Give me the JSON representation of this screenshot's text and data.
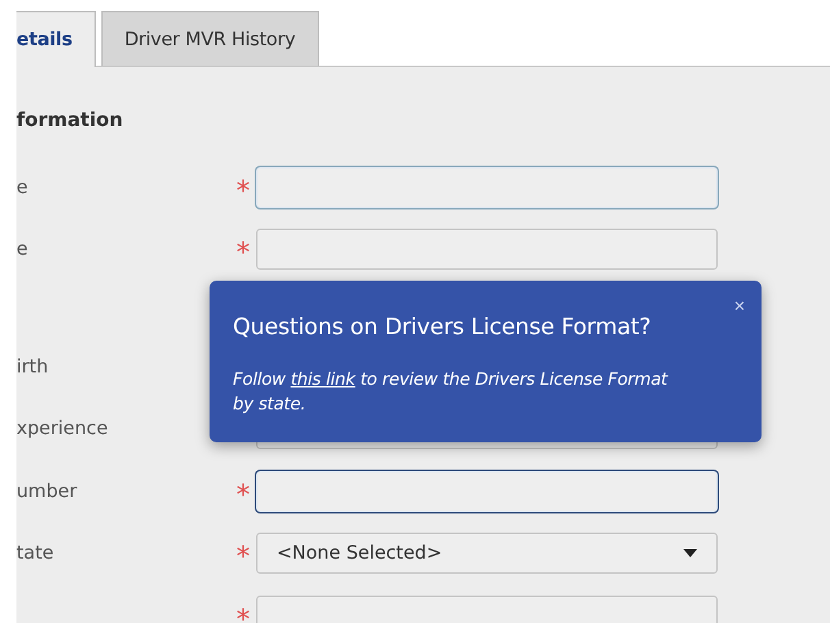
{
  "tabs": [
    {
      "label": "etails",
      "selected": true
    },
    {
      "label": "Driver MVR History",
      "selected": false
    }
  ],
  "section": {
    "title": "formation"
  },
  "rows": [
    {
      "label": "e",
      "required_mark": "*",
      "kind": "text",
      "focused": true
    },
    {
      "label": "e",
      "required_mark": "*",
      "kind": "text",
      "focused": false
    },
    {
      "label": "irth",
      "kind": "none"
    },
    {
      "label": "xperience",
      "kind": "text"
    },
    {
      "label": "umber",
      "required_mark": "*",
      "kind": "text",
      "focused": true
    },
    {
      "label": "tate",
      "required_mark": "*",
      "kind": "select",
      "value": "<None Selected>",
      "focused": false
    },
    {
      "required_mark": "*",
      "kind": "text",
      "focused": false
    }
  ],
  "popover": {
    "close": "×",
    "title": "Questions on Drivers License Format?",
    "text": "Follow ",
    "link": "this link",
    "text_after": " to review the Drivers License Format by state."
  }
}
